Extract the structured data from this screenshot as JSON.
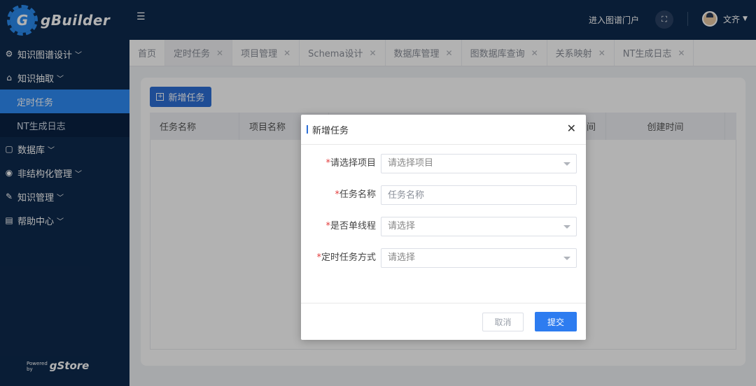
{
  "app": {
    "name": "gBuilder",
    "logo_letter": "G"
  },
  "sidebar": {
    "items": [
      {
        "label": "知识图谱设计",
        "icon": "chart-icon",
        "glyph": "⚙"
      },
      {
        "label": "知识抽取",
        "icon": "building-icon",
        "glyph": "⌂",
        "children": [
          {
            "label": "定时任务"
          },
          {
            "label": "NT生成日志"
          }
        ]
      },
      {
        "label": "数据库",
        "icon": "database-icon",
        "glyph": "▢"
      },
      {
        "label": "非结构化管理",
        "icon": "globe-icon",
        "glyph": "◉"
      },
      {
        "label": "知识管理",
        "icon": "edit-icon",
        "glyph": "✎"
      },
      {
        "label": "帮助中心",
        "icon": "help-icon",
        "glyph": "▤"
      }
    ],
    "powered": {
      "line1": "Powered",
      "line2": "by",
      "brand": "gStore"
    }
  },
  "header": {
    "portal_link": "进入图谱门户",
    "user_name": "文齐"
  },
  "tabs": [
    {
      "label": "首页",
      "closable": false
    },
    {
      "label": "定时任务",
      "closable": true,
      "active": true
    },
    {
      "label": "项目管理",
      "closable": true
    },
    {
      "label": "Schema设计",
      "closable": true
    },
    {
      "label": "数据库管理",
      "closable": true
    },
    {
      "label": "图数据库查询",
      "closable": true
    },
    {
      "label": "关系映射",
      "closable": true
    },
    {
      "label": "NT生成日志",
      "closable": true
    }
  ],
  "tab_close_glyph": "✕",
  "main": {
    "add_button": "新增任务",
    "columns": [
      "任务名称",
      "项目名称",
      "间",
      "创建时间"
    ]
  },
  "modal": {
    "title": "新增任务",
    "close_glyph": "✕",
    "required_mark": "*",
    "fields": [
      {
        "label": "请选择项目",
        "placeholder": "请选择项目",
        "type": "select"
      },
      {
        "label": "任务名称",
        "placeholder": "任务名称",
        "type": "text"
      },
      {
        "label": "是否单线程",
        "placeholder": "请选择",
        "type": "select"
      },
      {
        "label": "定时任务方式",
        "placeholder": "请选择",
        "type": "select"
      }
    ],
    "cancel_label": "取消",
    "submit_label": "提交"
  },
  "colors": {
    "sidebar_bg": "#0e2a4e",
    "accent": "#2d6fd6",
    "active_menu": "#2f8bf5",
    "required": "#e23c3c"
  }
}
